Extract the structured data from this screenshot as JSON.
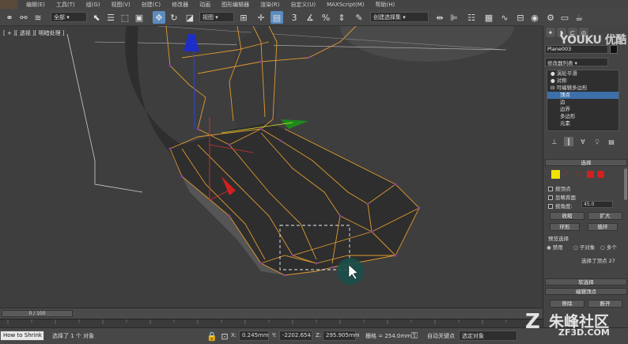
{
  "menubar": {
    "items": [
      "编辑(E)",
      "工具(T)",
      "组(G)",
      "视图(V)",
      "创建(C)",
      "修改器",
      "动画",
      "图形编辑器",
      "渲染(R)",
      "自定义(U)",
      "MAXScript(M)",
      "帮助(H)"
    ]
  },
  "toolbar": {
    "selection_filter": "全部",
    "ref_coord": "视图",
    "named_selection": "创建选择集"
  },
  "viewport": {
    "label": "[ + ][ 透视 ][ 明暗处理 ]"
  },
  "timeline": {
    "frame": "0 / 100"
  },
  "statusbar": {
    "left_text": "How to Shrink",
    "selected": "选择了 1 个 对象",
    "x_label": "X:",
    "x_value": "0.245mm",
    "y_label": "Y:",
    "y_value": "-2202.654",
    "z_label": "Z:",
    "z_value": "295.905mm",
    "grid": "栅格 = 254.0mm",
    "autokey": "自动关键点",
    "setkey_value": "选定对象"
  },
  "cmdpanel": {
    "object_name": "Plane003",
    "modifier_list": "修改器列表",
    "stack": [
      {
        "label": "涡轮平滑",
        "sel": false,
        "sub": false
      },
      {
        "label": "对称",
        "sel": false,
        "sub": false
      },
      {
        "label": "可编辑多边形",
        "sel": false,
        "sub": false
      },
      {
        "label": "顶点",
        "sel": true,
        "sub": true
      },
      {
        "label": "边",
        "sel": false,
        "sub": true
      },
      {
        "label": "边界",
        "sel": false,
        "sub": true
      },
      {
        "label": "多边形",
        "sel": false,
        "sub": true
      },
      {
        "label": "元素",
        "sel": false,
        "sub": true
      }
    ],
    "selection_rollout": "选择",
    "by_vertex": "按顶点",
    "ignore_backface": "忽略背面",
    "by_angle": "按角度:",
    "angle_value": "45.0",
    "shrink": "收缩",
    "grow": "扩大",
    "ring": "环形",
    "loop": "循环",
    "preview_sel": "预览选择",
    "disabled": "禁用",
    "subobject": "子对象",
    "multi": "多个",
    "selected_count": "选择了顶点 27",
    "soft_sel": "软选择",
    "edit_vertices": "编辑顶点",
    "remove": "移除",
    "break": "断开"
  },
  "watermarks": {
    "youku": "YOUKU 优酷",
    "zhufeng": "朱峰社区",
    "zhufeng_url": "ZF3D.COM"
  }
}
